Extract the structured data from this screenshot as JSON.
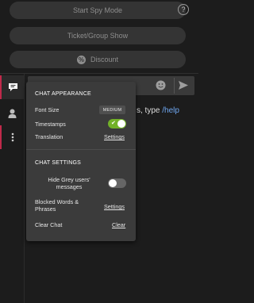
{
  "top_buttons": {
    "spy_mode_label": "Start Spy Mode",
    "ticket_label": "Ticket/Group Show",
    "discount_label": "Discount",
    "help_label": "?"
  },
  "sidebar": {
    "tabs": [
      {
        "name": "chat",
        "icon": "chat-bubble-icon",
        "active": true
      },
      {
        "name": "users",
        "icon": "user-icon",
        "active": false
      },
      {
        "name": "more",
        "icon": "more-vertical-icon",
        "active": false
      }
    ]
  },
  "chat": {
    "input_placeholder": "",
    "hint_text": "s, type ",
    "hint_command": "/help",
    "icons": [
      "emoji-icon",
      "send-icon"
    ]
  },
  "settings_panel": {
    "appearance_title": "CHAT APPEARANCE",
    "font_size_label": "Font Size",
    "font_size_value": "MEDIUM",
    "timestamps_label": "Timestamps",
    "timestamps_on": true,
    "translation_label": "Translation",
    "translation_link": "Settings",
    "settings_title": "CHAT SETTINGS",
    "hide_grey_label_line1": "Hide Grey users'",
    "hide_grey_label_line2": "messages",
    "hide_grey_on": false,
    "blocked_words_line1": "Blocked Words &",
    "blocked_words_line2": "Phrases",
    "blocked_words_link": "Settings",
    "clear_chat_label": "Clear Chat",
    "clear_chat_link": "Clear"
  },
  "colors": {
    "accent_red": "#c0294a",
    "toggle_green": "#72b128",
    "link_blue": "#6fa8f2",
    "panel_bg": "#3b3b3b"
  }
}
